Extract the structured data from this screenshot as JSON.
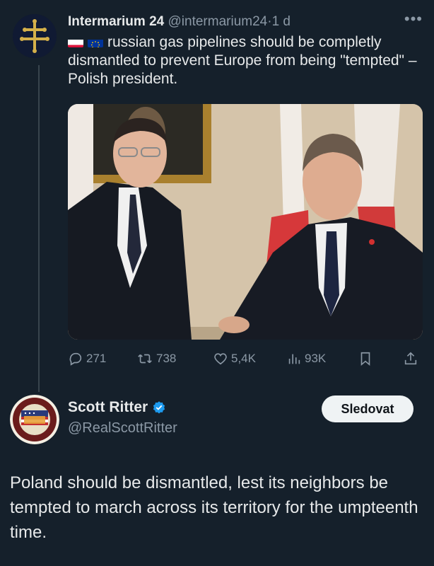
{
  "tweet1": {
    "display_name": "Intermarium 24",
    "handle": "@intermarium24",
    "separator": "·",
    "time": "1 d",
    "flags": [
      "poland-flag",
      "eu-flag"
    ],
    "text": "russian gas pipelines should be completly dismantled to prevent Europe from being \"tempted\" – Polish president.",
    "actions": {
      "replies": "271",
      "reposts": "738",
      "likes": "5,4K",
      "views": "93K"
    }
  },
  "tweet2": {
    "display_name": "Scott Ritter",
    "handle": "@RealScottRitter",
    "verified": true,
    "follow_label": "Sledovat",
    "text": "Poland should be dismantled, lest its neighbors be tempted to march across its territory for the umpteenth time."
  },
  "colors": {
    "background": "#15202b",
    "text": "#e7e9ea",
    "muted": "#8b98a5",
    "verified": "#1d9bf0",
    "follow_button_bg": "#eff3f4"
  }
}
